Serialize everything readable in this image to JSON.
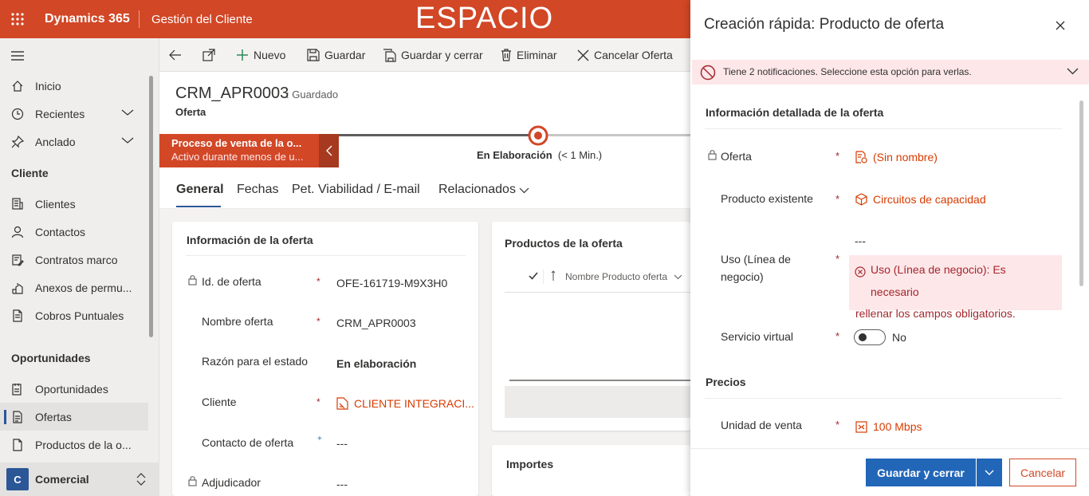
{
  "topbar": {
    "app_name": "Dynamics 365",
    "area": "Gestión del Cliente",
    "sandbox": "ESPACIO AISLADO"
  },
  "sidebar": {
    "items_top": [
      {
        "label": "Inicio"
      },
      {
        "label": "Recientes"
      },
      {
        "label": "Anclado"
      }
    ],
    "group1": {
      "title": "Cliente",
      "items": [
        {
          "label": "Clientes"
        },
        {
          "label": "Contactos"
        },
        {
          "label": "Contratos marco"
        },
        {
          "label": "Anexos de permu..."
        },
        {
          "label": "Cobros Puntuales"
        }
      ]
    },
    "group2": {
      "title": "Oportunidades",
      "items": [
        {
          "label": "Oportunidades"
        },
        {
          "label": "Ofertas"
        },
        {
          "label": "Productos de la o..."
        }
      ]
    },
    "area_switcher": {
      "badge": "C",
      "label": "Comercial"
    }
  },
  "commands": {
    "new": "Nuevo",
    "save": "Guardar",
    "save_close": "Guardar y cerrar",
    "delete": "Eliminar",
    "cancel_offer": "Cancelar Oferta"
  },
  "record": {
    "title": "CRM_APR0003",
    "status": ": Guardado",
    "entity": "Oferta"
  },
  "bpf": {
    "stage_title": "Proceso de venta de la o...",
    "stage_sub": "Activo durante menos de u...",
    "active_stage": "En Elaboración",
    "duration": "(< 1 Min.)"
  },
  "tabs": [
    {
      "label": "General"
    },
    {
      "label": "Fechas"
    },
    {
      "label": "Pet. Viabilidad / E-mail"
    },
    {
      "label": "Relacionados"
    }
  ],
  "section_info": {
    "title": "Información de la oferta",
    "fields": [
      {
        "label": "Id. de oferta",
        "value": "OFE-161719-M9X3H0"
      },
      {
        "label": "Nombre oferta",
        "value": "CRM_APR0003"
      },
      {
        "label": "Razón para el estado",
        "value": "En elaboración"
      },
      {
        "label": "Cliente",
        "value": "CLIENTE INTEGRACI..."
      },
      {
        "label": "Contacto de oferta",
        "value": "---"
      },
      {
        "label": "Adjudicador",
        "value": "---"
      }
    ]
  },
  "section_products": {
    "title": "Productos de la oferta",
    "column": "Nombre Producto oferta"
  },
  "section_amounts": {
    "title": "Importes"
  },
  "quick_create": {
    "title": "Creación rápida: Producto de oferta",
    "notification": "Tiene 2 notificaciones. Seleccione esta opción para verlas.",
    "section1_title": "Información detallada de la oferta",
    "offer_label": "Oferta",
    "offer_value": "(Sin nombre)",
    "product_label": "Producto existente",
    "product_value": "Circuitos de capacidad",
    "usage_label_1": "Uso (Línea de",
    "usage_label_2": "negocio)",
    "usage_value": "---",
    "usage_error_1": "Uso (Línea de negocio): Es necesario",
    "usage_error_2": "rellenar los campos obligatorios.",
    "virtual_label": "Servicio virtual",
    "virtual_value": "No",
    "section2_title": "Precios",
    "unit_label": "Unidad de venta",
    "unit_value": "100 Mbps",
    "save_close": "Guardar y cerrar",
    "cancel": "Cancelar"
  },
  "colors": {
    "brand": "#d24726",
    "primary": "#2266b8",
    "error": "#a4262c",
    "link": "#d83b01"
  }
}
